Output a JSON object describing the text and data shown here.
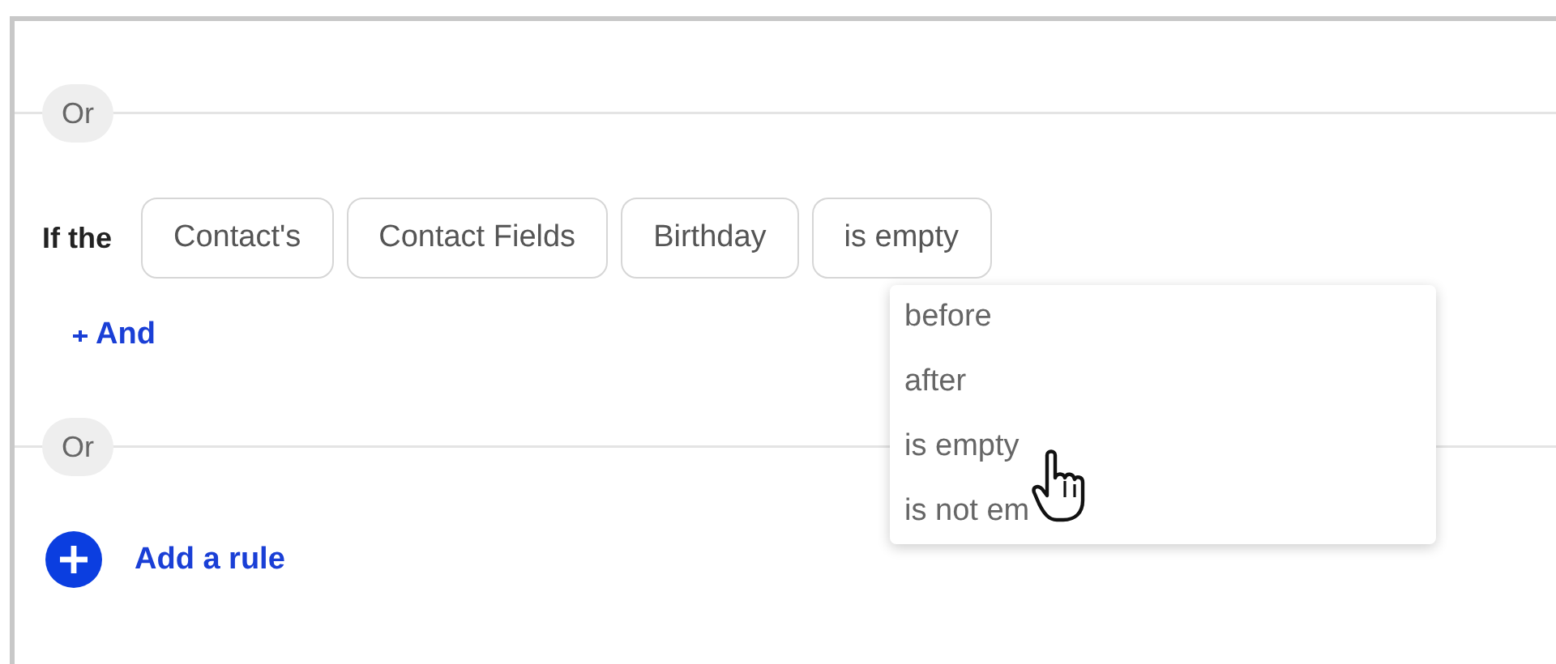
{
  "groups": [
    {
      "separator": "Or",
      "prefix": "If the",
      "chips": [
        "Contact's",
        "Contact Fields",
        "Birthday",
        "is empty"
      ],
      "add_condition": "And"
    },
    {
      "separator": "Or"
    }
  ],
  "dropdown": {
    "options": [
      "before",
      "after",
      "is empty",
      "is not em"
    ]
  },
  "add_rule": "Add a rule"
}
